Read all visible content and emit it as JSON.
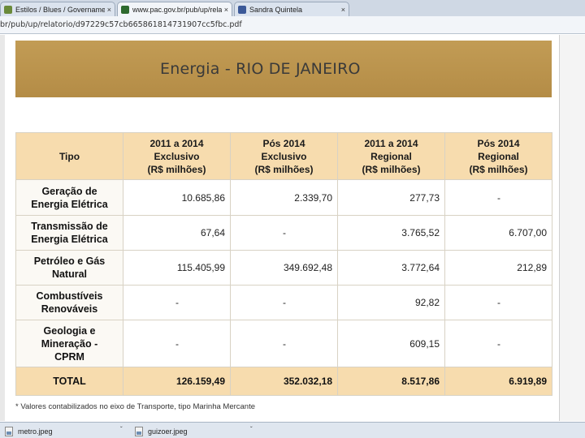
{
  "browser": {
    "tabs": [
      {
        "title": "Estilos / Blues / Governamental",
        "icon_color": "#6a8a3a",
        "active": false
      },
      {
        "title": "www.pac.gov.br/pub/up/relatorio",
        "icon_color": "#2e6a2e",
        "active": true
      },
      {
        "title": "Sandra Quintela",
        "icon_color": "#3b5998",
        "active": false
      }
    ],
    "close_glyph": "×",
    "url": "br/pub/up/relatorio/d97229c57cb665861814731907cc5fbc.pdf"
  },
  "document": {
    "banner_title": "Energia - RIO DE JANEIRO",
    "table": {
      "headers": [
        {
          "l1": "Tipo",
          "l2": "",
          "l3": ""
        },
        {
          "l1": "2011 a 2014",
          "l2": "Exclusivo",
          "l3": "(R$ milhões)"
        },
        {
          "l1": "Pós 2014",
          "l2": "Exclusivo",
          "l3": "(R$ milhões)"
        },
        {
          "l1": "2011 a 2014",
          "l2": "Regional",
          "l3": "(R$ milhões)"
        },
        {
          "l1": "Pós 2014",
          "l2": "Regional",
          "l3": "(R$ milhões)"
        }
      ],
      "rows": [
        {
          "type": [
            "Geração de",
            "Energia Elétrica"
          ],
          "values": [
            "10.685,86",
            "2.339,70",
            "277,73",
            "-"
          ]
        },
        {
          "type": [
            "Transmissão de",
            "Energia Elétrica"
          ],
          "values": [
            "67,64",
            "-",
            "3.765,52",
            "6.707,00"
          ]
        },
        {
          "type": [
            "Petróleo e Gás",
            "Natural"
          ],
          "values": [
            "115.405,99",
            "349.692,48",
            "3.772,64",
            "212,89"
          ]
        },
        {
          "type": [
            "Combustíveis",
            "Renováveis"
          ],
          "values": [
            "-",
            "-",
            "92,82",
            "-"
          ]
        },
        {
          "type": [
            "Geologia e",
            "Mineração -",
            "CPRM"
          ],
          "values": [
            "-",
            "-",
            "609,15",
            "-"
          ]
        }
      ],
      "total": {
        "label": "TOTAL",
        "values": [
          "126.159,49",
          "352.032,18",
          "8.517,86",
          "6.919,89"
        ]
      }
    },
    "footnote": "* Valores contabilizados no eixo de Transporte, tipo Marinha Mercante"
  },
  "downloads": [
    {
      "name": "metro.jpeg",
      "caret": "ˇ"
    },
    {
      "name": "guizoer.jpeg",
      "caret": "ˇ"
    }
  ]
}
